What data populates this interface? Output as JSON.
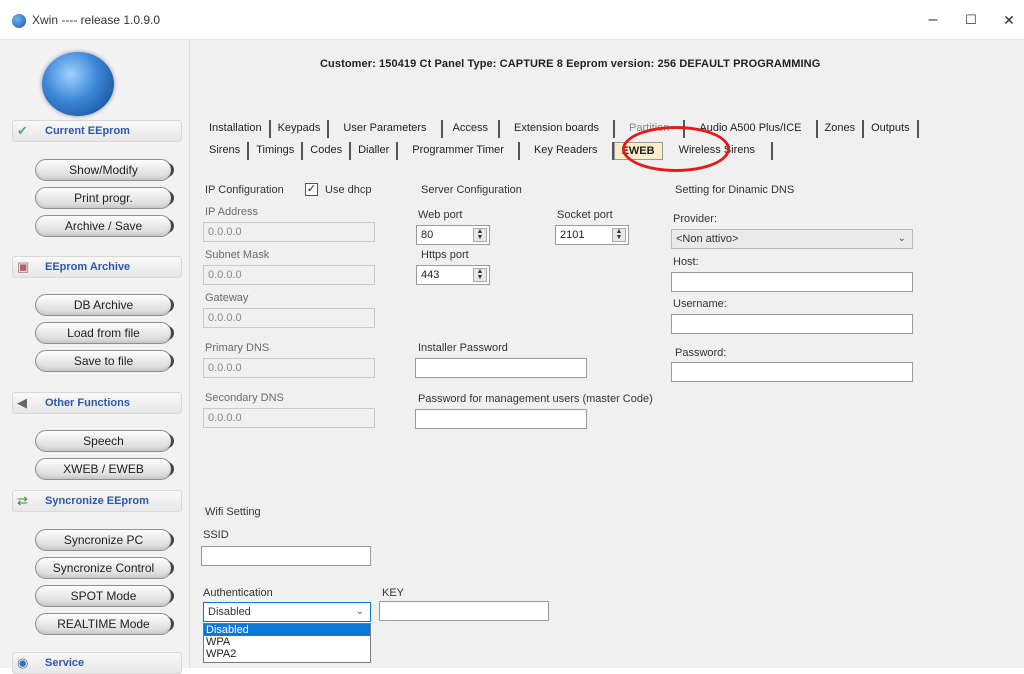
{
  "window": {
    "title": "Xwin ---- release 1.0.9.0",
    "minimize": "–",
    "maximize": "☐",
    "close": "✕"
  },
  "header": {
    "info": "Customer: 150419 Ct Panel Type: CAPTURE 8 Eeprom version: 256  DEFAULT PROGRAMMING"
  },
  "sidebar": {
    "sections": [
      {
        "title": "Current EEprom",
        "icon": "check-shield-icon",
        "buttons": [
          "Show/Modify",
          "Print progr.",
          "Archive / Save"
        ]
      },
      {
        "title": "EEprom Archive",
        "icon": "archive-icon",
        "buttons": [
          "DB Archive",
          "Load from file",
          "Save to file"
        ]
      },
      {
        "title": "Other Functions",
        "icon": "speaker-icon",
        "buttons": [
          "Speech",
          "XWEB / EWEB"
        ]
      },
      {
        "title": "Syncronize EEprom",
        "icon": "sync-icon",
        "buttons": [
          "Syncronize PC",
          "Syncronize Control",
          "SPOT Mode",
          "REALTIME Mode"
        ]
      },
      {
        "title": "Service",
        "icon": "service-icon"
      }
    ]
  },
  "tabs": {
    "row1": [
      "Installation",
      "Keypads",
      "User Parameters",
      "Access",
      "Extension boards",
      "Partition",
      "Audio A500 Plus/ICE",
      "Zones",
      "Outputs"
    ],
    "row2": [
      "Sirens",
      "Timings",
      "Codes",
      "Dialler",
      "Programmer Timer",
      "Key Readers",
      "EWEB",
      "Wireless Sirens"
    ],
    "active": "EWEB"
  },
  "ip": {
    "section_label": "IP Configuration",
    "use_dhcp_label": "Use dhcp",
    "use_dhcp_checked": true,
    "ip_address_label": "IP Address",
    "ip_address_value": "0.0.0.0",
    "subnet_label": "Subnet Mask",
    "subnet_value": "0.0.0.0",
    "gateway_label": "Gateway",
    "gateway_value": "0.0.0.0",
    "primary_dns_label": "Primary DNS",
    "primary_dns_value": "0.0.0.0",
    "secondary_dns_label": "Secondary DNS",
    "secondary_dns_value": "0.0.0.0"
  },
  "server": {
    "section_label": "Server Configuration",
    "web_port_label": "Web port",
    "web_port_value": "80",
    "socket_port_label": "Socket port",
    "socket_port_value": "2101",
    "https_port_label": "Https port",
    "https_port_value": "443",
    "installer_password_label": "Installer Password",
    "master_password_label": "Password for management users (master Code)"
  },
  "ddns": {
    "section_label": "Setting for Dinamic DNS",
    "provider_label": "Provider:",
    "provider_value": "<Non attivo>",
    "host_label": "Host:",
    "username_label": "Username:",
    "password_label": "Password:"
  },
  "wifi": {
    "section_label": "Wifi Setting",
    "ssid_label": "SSID",
    "auth_label": "Authentication",
    "auth_value": "Disabled",
    "key_label": "KEY",
    "auth_options": [
      "Disabled",
      "WPA",
      "WPA2"
    ]
  },
  "colors": {
    "highlight_circle": "#e21c1c",
    "dropdown_selection": "#0a78d7",
    "section_title": "#2b59a8"
  }
}
